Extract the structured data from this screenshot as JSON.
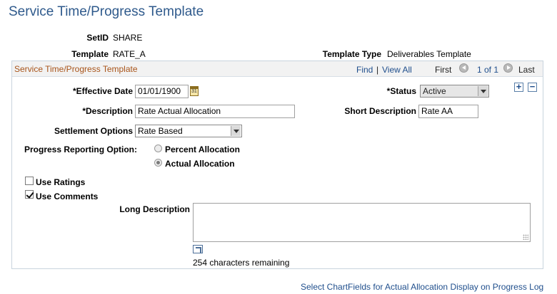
{
  "page": {
    "title": "Service Time/Progress Template"
  },
  "header_fields": {
    "setid_label": "SetID",
    "setid_value": "SHARE",
    "template_label": "Template",
    "template_value": "RATE_A",
    "template_type_label": "Template Type",
    "template_type_value": "Deliverables Template"
  },
  "group": {
    "title": "Service Time/Progress Template",
    "find": "Find",
    "separator": "|",
    "view_all": "View All",
    "first": "First",
    "range": "1 of 1",
    "last": "Last"
  },
  "form": {
    "effective_date_label": "*Effective Date",
    "effective_date_value": "01/01/1900",
    "status_label": "*Status",
    "status_value": "Active",
    "description_label": "*Description",
    "description_value": "Rate Actual Allocation",
    "short_description_label": "Short Description",
    "short_description_value": "Rate AA",
    "settlement_label": "Settlement Options",
    "settlement_value": "Rate Based",
    "progress_label": "Progress Reporting Option:",
    "radio_percent": "Percent Allocation",
    "radio_actual": "Actual Allocation",
    "selected_progress_option": "Actual Allocation",
    "use_ratings_label": "Use Ratings",
    "use_ratings_checked": false,
    "use_comments_label": "Use Comments",
    "use_comments_checked": true,
    "long_description_label": "Long Description",
    "long_description_value": "",
    "chars_remaining": "254 characters remaining",
    "add_row": "+",
    "delete_row": "−"
  },
  "footer": {
    "chartfields_link": "Select ChartFields for Actual Allocation Display on Progress Log"
  },
  "icons": {
    "calendar": "calendar-icon",
    "previous": "previous-arrow-icon",
    "next": "next-arrow-icon",
    "expand": "expand-textarea-icon",
    "resize": "resize-grip-icon"
  },
  "colors": {
    "title": "#2f5a8c",
    "group_title": "#a8541a",
    "link": "#1f4e8c"
  }
}
